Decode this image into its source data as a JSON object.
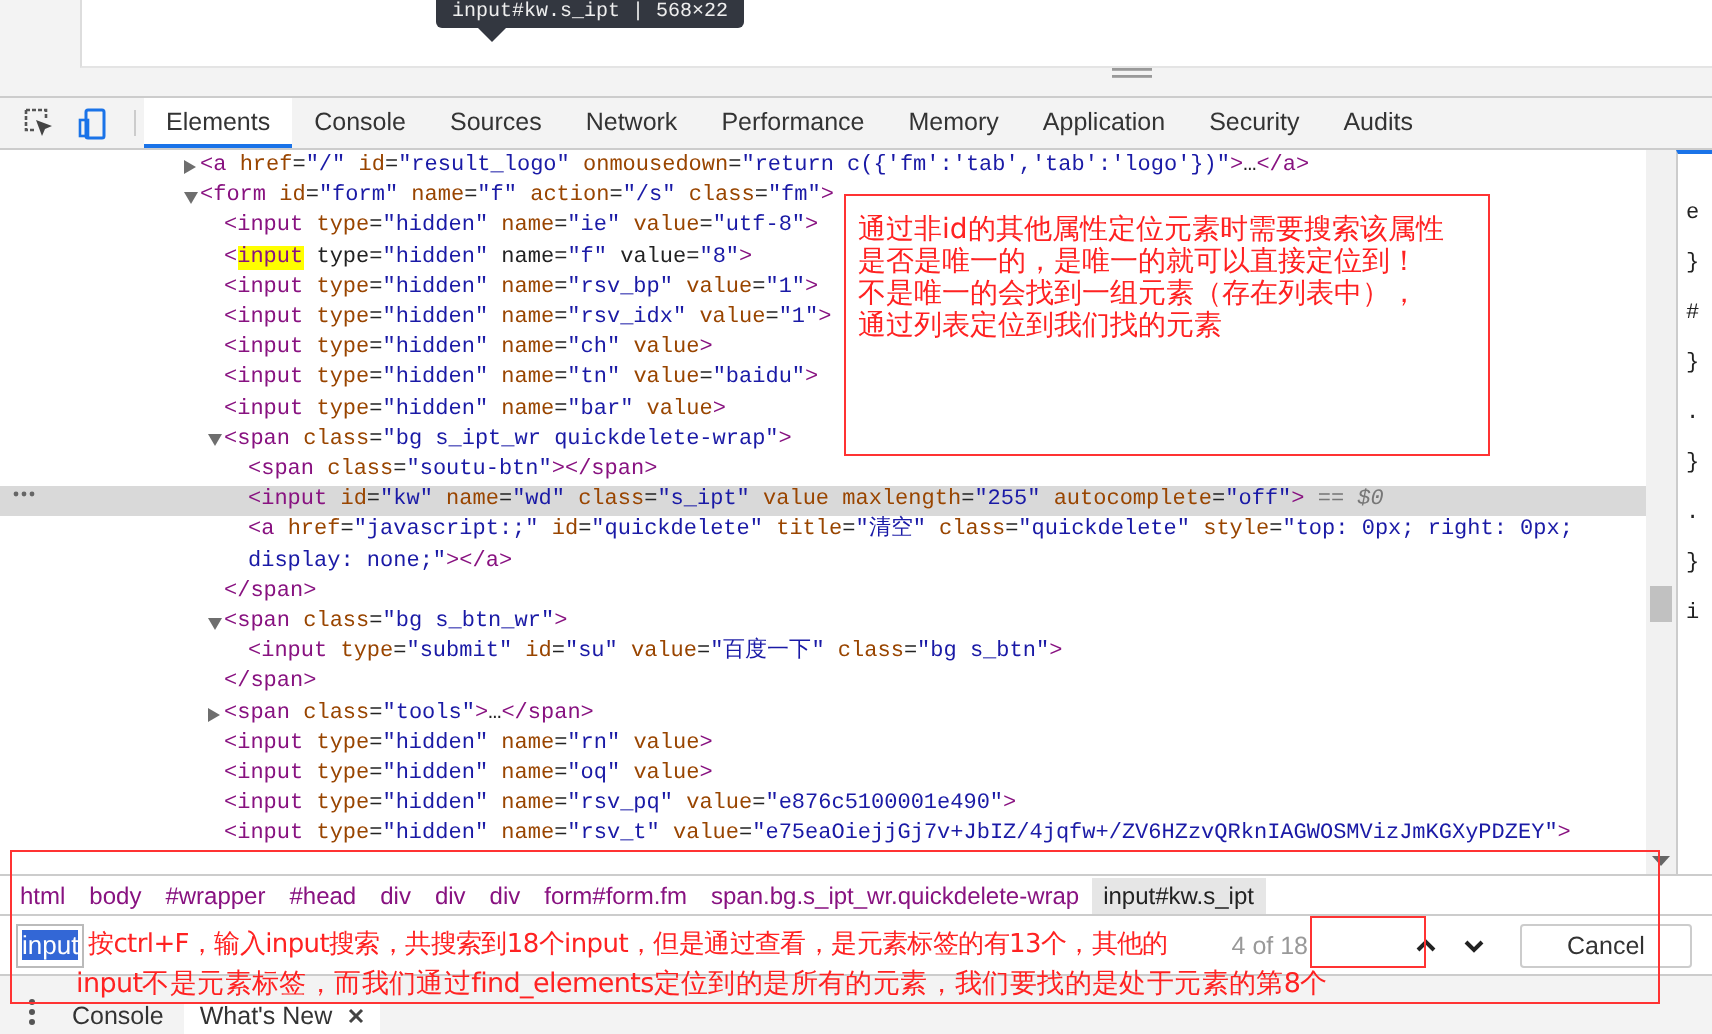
{
  "tooltip": {
    "text": "input#kw.s_ipt | 568×22"
  },
  "tabs": [
    {
      "label": "Elements",
      "selected": true
    },
    {
      "label": "Console",
      "selected": false
    },
    {
      "label": "Sources",
      "selected": false
    },
    {
      "label": "Network",
      "selected": false
    },
    {
      "label": "Performance",
      "selected": false
    },
    {
      "label": "Memory",
      "selected": false
    },
    {
      "label": "Application",
      "selected": false
    },
    {
      "label": "Security",
      "selected": false
    },
    {
      "label": "Audits",
      "selected": false
    }
  ],
  "dom_tree": [
    {
      "text": "<a href=\"/\" id=\"result_logo\" onmousedown=\"return c({'fm':'tab','tab':'logo'})\">…</a>",
      "expanded": false,
      "selected": false,
      "search_hit": false
    },
    {
      "text": "<form id=\"form\" name=\"f\" action=\"/s\" class=\"fm\">",
      "expanded": true,
      "selected": false,
      "search_hit": false,
      "children": [
        {
          "text": "<input type=\"hidden\" name=\"ie\" value=\"utf-8\">",
          "selected": false,
          "search_hit": false
        },
        {
          "text": "<input type=\"hidden\" name=\"f\" value=\"8\">",
          "selected": false,
          "search_hit": true
        },
        {
          "text": "<input type=\"hidden\" name=\"rsv_bp\" value=\"1\">",
          "selected": false,
          "search_hit": false
        },
        {
          "text": "<input type=\"hidden\" name=\"rsv_idx\" value=\"1\">",
          "selected": false,
          "search_hit": false
        },
        {
          "text": "<input type=\"hidden\" name=\"ch\" value>",
          "selected": false,
          "search_hit": false
        },
        {
          "text": "<input type=\"hidden\" name=\"tn\" value=\"baidu\">",
          "selected": false,
          "search_hit": false
        },
        {
          "text": "<input type=\"hidden\" name=\"bar\" value>",
          "selected": false,
          "search_hit": false
        },
        {
          "text": "<span class=\"bg s_ipt_wr quickdelete-wrap\">",
          "expanded": true,
          "selected": false,
          "search_hit": false,
          "closing": "</span>",
          "children": [
            {
              "text": "<span class=\"soutu-btn\"></span>",
              "selected": false,
              "search_hit": false
            },
            {
              "text": "<input id=\"kw\" name=\"wd\" class=\"s_ipt\" value maxlength=\"255\" autocomplete=\"off\">",
              "selected": true,
              "search_hit": false,
              "suffix": "== $0"
            },
            {
              "text": "<a href=\"javascript:;\" id=\"quickdelete\" title=\"清空\" class=\"quickdelete\" style=\"top: 0px; right: 0px; display: none;\"></a>",
              "selected": false,
              "search_hit": false
            }
          ]
        },
        {
          "text": "<span class=\"bg s_btn_wr\">",
          "expanded": true,
          "selected": false,
          "search_hit": false,
          "closing": "</span>",
          "children": [
            {
              "text": "<input type=\"submit\" id=\"su\" value=\"百度一下\" class=\"bg s_btn\">",
              "selected": false,
              "search_hit": false
            }
          ]
        },
        {
          "text": "<span class=\"tools\">…</span>",
          "expanded": false,
          "selected": false,
          "search_hit": false
        },
        {
          "text": "<input type=\"hidden\" name=\"rn\" value>",
          "selected": false,
          "search_hit": false
        },
        {
          "text": "<input type=\"hidden\" name=\"oq\" value>",
          "selected": false,
          "search_hit": false
        },
        {
          "text": "<input type=\"hidden\" name=\"rsv_pq\" value=\"e876c5100001e490\">",
          "selected": false,
          "search_hit": false
        },
        {
          "text": "<input type=\"hidden\" name=\"rsv_t\" value=\"e75eaOiejjGj7v+JbIZ/4jqfw+/ZV6HZzvQRknIAGWOSMVizJmKGXyPDZEY\">",
          "selected": false,
          "search_hit": false
        }
      ]
    }
  ],
  "styles_pane": [
    "e",
    "}",
    "#",
    "}",
    ".",
    "}",
    ".",
    "}",
    "i"
  ],
  "breadcrumbs": [
    {
      "label": "html",
      "selected": false
    },
    {
      "label": "body",
      "selected": false
    },
    {
      "label": "#wrapper",
      "selected": false
    },
    {
      "label": "#head",
      "selected": false
    },
    {
      "label": "div",
      "selected": false
    },
    {
      "label": "div",
      "selected": false
    },
    {
      "label": "div",
      "selected": false
    },
    {
      "label": "form#form.fm",
      "selected": false
    },
    {
      "label": "span.bg.s_ipt_wr.quickdelete-wrap",
      "selected": false
    },
    {
      "label": "input#kw.s_ipt",
      "selected": true
    }
  ],
  "find_bar": {
    "value": "input",
    "count": "4 of 18",
    "cancel": "Cancel"
  },
  "drawer_tabs": [
    {
      "label": "Console",
      "selected": false,
      "closable": false
    },
    {
      "label": "What's New",
      "selected": true,
      "closable": true
    }
  ],
  "annotations": [
    {
      "kind": "box",
      "lines": [
        "通过非id的其他属性定位元素时需要搜索该属性",
        "是否是唯一的，是唯一的就可以直接定位到！",
        "不是唯一的会找到一组元素（存在列表中），",
        "通过列表定位到我们找的元素"
      ]
    },
    {
      "kind": "overlay",
      "lines": [
        "按ctrl+F，输入input搜索，共搜索到18个input，但是通过查看，是元素标签的有13个，其他的",
        "input不是元素标签，而我们通过find_elements定位到的是所有的元素，我们要找的是处于元素的第8个"
      ]
    }
  ]
}
